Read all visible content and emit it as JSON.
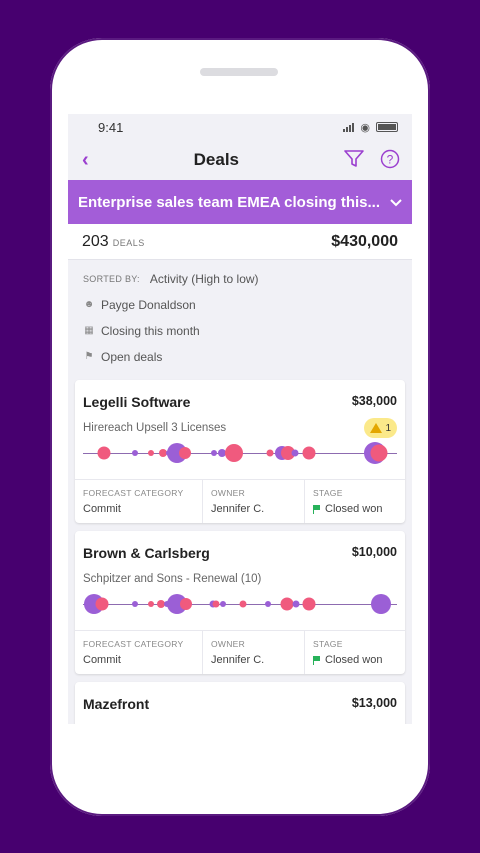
{
  "status": {
    "time": "9:41"
  },
  "nav": {
    "title": "Deals",
    "back_icon": "chevron-left-icon",
    "filter_icon": "filter-icon",
    "help_icon": "help-icon"
  },
  "banner": {
    "text": "Enterprise sales team EMEA closing this..."
  },
  "summary": {
    "count": "203",
    "count_label": "DEALS",
    "total": "$430,000"
  },
  "filters": {
    "sorted_by_label": "SORTED BY:",
    "sorted_by_value": "Activity (High to low)",
    "owner": "Payge Donaldson",
    "closing": "Closing this month",
    "deals": "Open deals"
  },
  "colors": {
    "accent": "#9b3fcf",
    "banner": "#a35dd8",
    "pink": "#f05a7e",
    "purple": "#9b5fd6",
    "won": "#27b25a",
    "warn": "#fbe98a"
  },
  "cards": [
    {
      "name": "Legelli Software",
      "amount": "$38,000",
      "deal": "Hirereach Upsell 3 Licenses",
      "warning_count": "1",
      "forecast_label": "FORECAST CATEGORY",
      "forecast": "Commit",
      "owner_label": "OWNER",
      "owner": "Jennifer C.",
      "stage_label": "STAGE",
      "stage": "Closed won"
    },
    {
      "name": "Brown & Carlsberg",
      "amount": "$10,000",
      "deal": "Schpitzer and Sons - Renewal (10)",
      "forecast_label": "FORECAST CATEGORY",
      "forecast": "Commit",
      "owner_label": "OWNER",
      "owner": "Jennifer C.",
      "stage_label": "STAGE",
      "stage": "Closed won"
    },
    {
      "name": "Mazefront",
      "amount": "$13,000"
    }
  ]
}
